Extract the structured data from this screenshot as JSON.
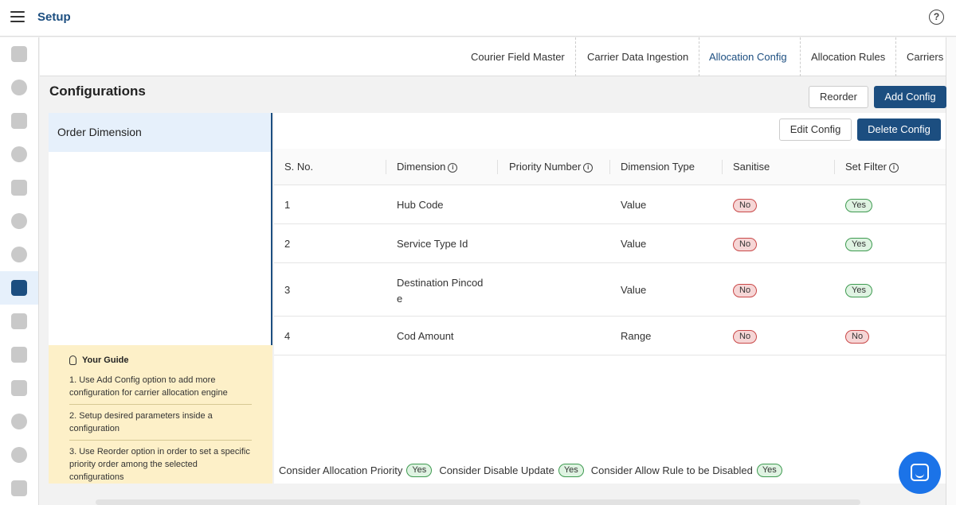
{
  "header": {
    "title": "Setup",
    "menu_icon": "hamburger-icon",
    "help_icon": "help-icon",
    "help_glyph": "?"
  },
  "sidebar": {
    "icons": [
      "dashboard-icon",
      "settings-cog-icon",
      "briefcase-icon",
      "gear-icon",
      "vehicle-icon",
      "steering-icon",
      "cloud-icon",
      "user-badge-icon",
      "truck-icon",
      "warehouse-icon",
      "list-icon",
      "location-pin-icon",
      "security-settings-icon",
      "clipboard-icon"
    ],
    "active_index": 7
  },
  "tabs": [
    {
      "label": "Courier Field Master",
      "active": false
    },
    {
      "label": "Carrier Data Ingestion",
      "active": false
    },
    {
      "label": "Allocation Config",
      "active": true
    },
    {
      "label": "Allocation Rules",
      "active": false
    },
    {
      "label": "Carriers",
      "active": false
    }
  ],
  "page": {
    "title": "Configurations",
    "reorder_label": "Reorder",
    "add_config_label": "Add Config"
  },
  "config_list": {
    "items": [
      {
        "label": "Order Dimension",
        "selected": true
      }
    ]
  },
  "guide": {
    "title": "Your Guide",
    "icon": "lightbulb-icon",
    "items": [
      "1. Use Add Config option to add more configuration for carrier allocation engine",
      "2. Setup desired parameters inside a configuration",
      "3. Use Reorder option in order to set a specific priority order among the selected configurations"
    ]
  },
  "table": {
    "edit_label": "Edit Config",
    "delete_label": "Delete Config",
    "columns": [
      "S. No.",
      "Dimension",
      "Priority Number",
      "Dimension Type",
      "Sanitise",
      "Set Filter"
    ],
    "info_glyph": "i",
    "rows": [
      {
        "sno": "1",
        "dimension": "Hub Code",
        "priority": "",
        "type": "Value",
        "sanitise": "No",
        "set_filter": "Yes"
      },
      {
        "sno": "2",
        "dimension": "Service Type Id",
        "priority": "",
        "type": "Value",
        "sanitise": "No",
        "set_filter": "Yes"
      },
      {
        "sno": "3",
        "dimension": "Destination Pincode",
        "priority": "",
        "type": "Value",
        "sanitise": "No",
        "set_filter": "Yes"
      },
      {
        "sno": "4",
        "dimension": "Cod Amount",
        "priority": "",
        "type": "Range",
        "sanitise": "No",
        "set_filter": "No"
      }
    ]
  },
  "footer_flags": [
    {
      "label": "Consider Allocation Priority",
      "value": "Yes"
    },
    {
      "label": "Consider Disable Update",
      "value": "Yes"
    },
    {
      "label": "Consider Allow Rule to be Disabled",
      "value": "Yes"
    }
  ],
  "colors": {
    "primary": "#1c4e80",
    "selected_bg": "#e6f0fb",
    "guide_bg": "#fdf0c8",
    "no_badge": "#c94848",
    "yes_badge": "#3e9a50",
    "chat": "#1b73e8"
  }
}
